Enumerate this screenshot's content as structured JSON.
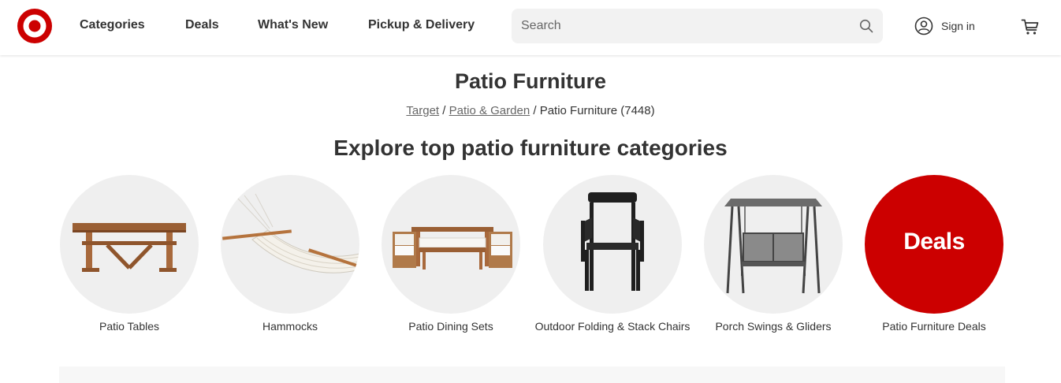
{
  "header": {
    "logo_icon": "target-bullseye-logo",
    "nav": [
      "Categories",
      "Deals",
      "What's New",
      "Pickup & Delivery"
    ],
    "search": {
      "placeholder": "Search",
      "icon": "search-icon"
    },
    "signin_label": "Sign in",
    "cart_icon": "cart-icon",
    "brand_color": "#cc0000"
  },
  "page": {
    "title": "Patio Furniture",
    "breadcrumb": {
      "items": [
        "Target",
        "Patio & Garden"
      ],
      "separator": "/",
      "current": "Patio Furniture",
      "count": "(7448)"
    },
    "section_title": "Explore top patio furniture categories"
  },
  "categories": [
    {
      "label": "Patio Tables",
      "image": "wooden-patio-table"
    },
    {
      "label": "Hammocks",
      "image": "rope-hammock"
    },
    {
      "label": "Patio Dining Sets",
      "image": "patio-dining-set"
    },
    {
      "label": "Outdoor Folding & Stack Chairs",
      "image": "black-stack-chair"
    },
    {
      "label": "Porch Swings & Gliders",
      "image": "porch-swing"
    },
    {
      "label": "Patio Furniture Deals",
      "image": "deals-badge",
      "badge_text": "Deals"
    }
  ]
}
